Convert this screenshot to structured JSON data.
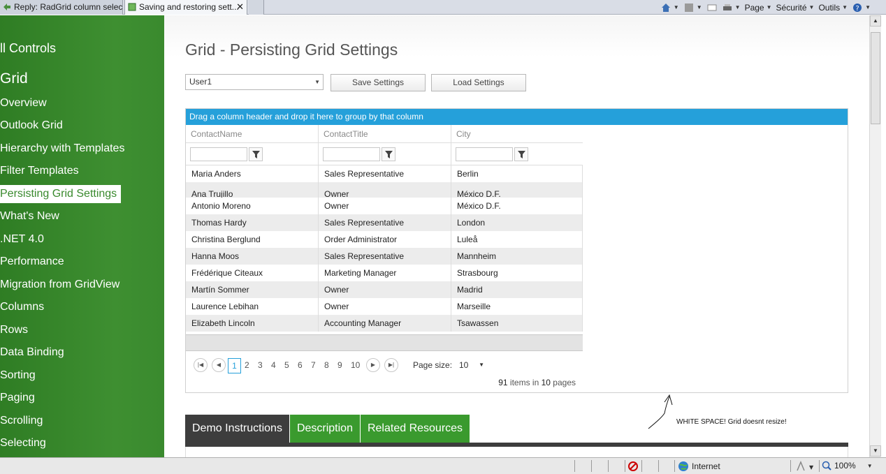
{
  "browser": {
    "tabs": [
      {
        "label": "Reply: RadGrid column selec..."
      },
      {
        "label": "Saving and restoring sett...",
        "close": "✕"
      }
    ],
    "commands": {
      "page": "Page",
      "security": "Sécurité",
      "tools": "Outils"
    }
  },
  "sidebar": {
    "all_controls": "ll Controls",
    "section": "Grid",
    "items": [
      {
        "label": "Overview"
      },
      {
        "label": "Outlook Grid"
      },
      {
        "label": "Hierarchy with Templates"
      },
      {
        "label": "Filter Templates"
      },
      {
        "label": "Persisting Grid Settings",
        "active": true
      },
      {
        "label": "What's New"
      },
      {
        "label": ".NET 4.0"
      },
      {
        "label": "Performance"
      },
      {
        "label": "Migration from GridView"
      },
      {
        "label": "Columns"
      },
      {
        "label": "Rows"
      },
      {
        "label": "Data Binding"
      },
      {
        "label": "Sorting"
      },
      {
        "label": "Paging"
      },
      {
        "label": "Scrolling"
      },
      {
        "label": "Selecting"
      }
    ]
  },
  "main": {
    "title": "Grid - Persisting Grid Settings",
    "user_select": "User1",
    "save_label": "Save Settings",
    "load_label": "Load Settings"
  },
  "grid": {
    "group_panel": "Drag a column header and drop it here to group by that column",
    "columns": [
      "ContactName",
      "ContactTitle",
      "City"
    ],
    "rows": [
      [
        "Maria Anders",
        "Sales Representative",
        "Berlin"
      ],
      [
        "Ana Trujillo",
        "Owner",
        "México D.F."
      ],
      [
        "Antonio Moreno",
        "Owner",
        "México D.F."
      ],
      [
        "Thomas Hardy",
        "Sales Representative",
        "London"
      ],
      [
        "Christina Berglund",
        "Order Administrator",
        "Luleå"
      ],
      [
        "Hanna Moos",
        "Sales Representative",
        "Mannheim"
      ],
      [
        "Frédérique Citeaux",
        "Marketing Manager",
        "Strasbourg"
      ],
      [
        "Martín Sommer",
        "Owner",
        "Madrid"
      ],
      [
        "Laurence Lebihan",
        "Owner",
        "Marseille"
      ],
      [
        "Elizabeth Lincoln",
        "Accounting Manager",
        "Tsawassen"
      ]
    ],
    "pager": {
      "pages": [
        "1",
        "2",
        "3",
        "4",
        "5",
        "6",
        "7",
        "8",
        "9",
        "10"
      ],
      "current": "1",
      "page_size_label": "Page size:",
      "page_size": "10",
      "total_items": "91",
      "items_in": "items in",
      "total_pages": "10",
      "pages_word": "pages"
    }
  },
  "annotation": "WHITE SPACE! Grid doesnt resize!",
  "demo_tabs": [
    "Demo Instructions",
    "Description",
    "Related Resources"
  ],
  "status": {
    "zone": "Internet",
    "zoom": "100%"
  },
  "colors": {
    "sidebar": "#3a8a2e",
    "accent": "#25a0da",
    "tab_active": "#3d3d3d"
  }
}
